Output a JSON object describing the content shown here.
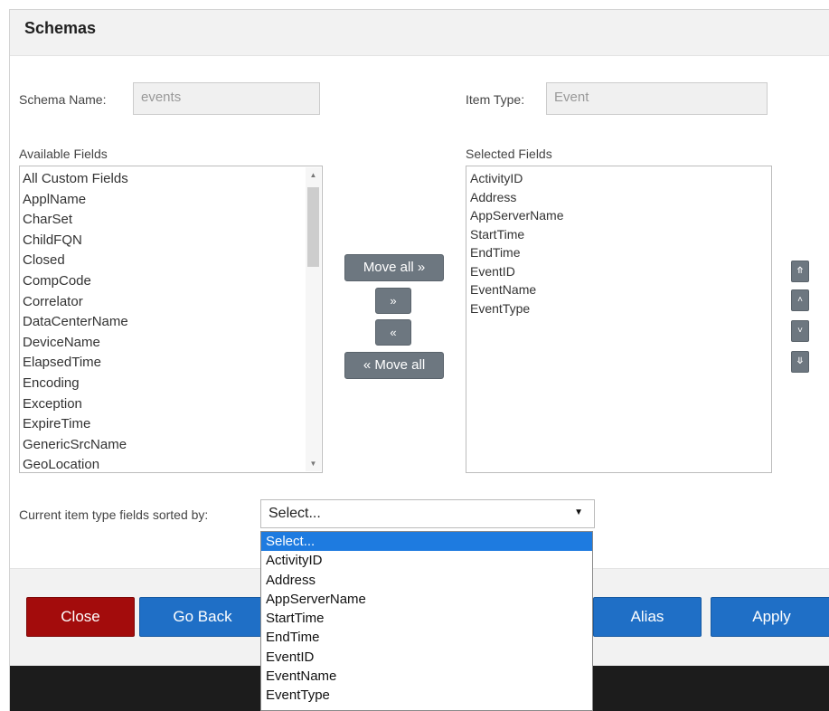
{
  "dialog": {
    "title": "Schemas"
  },
  "schema_name": {
    "label": "Schema Name:",
    "value": "events"
  },
  "item_type": {
    "label": "Item Type:",
    "value": "Event"
  },
  "available_fields": {
    "label": "Available Fields",
    "items": [
      "All Custom Fields",
      "ApplName",
      "CharSet",
      "ChildFQN",
      "Closed",
      "CompCode",
      "Correlator",
      "DataCenterName",
      "DeviceName",
      "ElapsedTime",
      "Encoding",
      "Exception",
      "ExpireTime",
      "GenericSrcName",
      "GeoLocation"
    ]
  },
  "selected_fields": {
    "label": "Selected Fields",
    "items": [
      "ActivityID",
      "Address",
      "AppServerName",
      "StartTime",
      "EndTime",
      "EventID",
      "EventName",
      "EventType"
    ]
  },
  "transfer_buttons": {
    "move_all_right": "Move all »",
    "move_right": "»",
    "move_left": "«",
    "move_all_left": "« Move all"
  },
  "order_buttons": {
    "to_top": "⤊",
    "up": "˄",
    "down": "˅",
    "to_bottom": "⤋"
  },
  "sort": {
    "label": "Current item type fields sorted by:",
    "selected": "Select...",
    "options": [
      "Select...",
      "ActivityID",
      "Address",
      "AppServerName",
      "StartTime",
      "EndTime",
      "EventID",
      "EventName",
      "EventType"
    ]
  },
  "footer": {
    "close": "Close",
    "go_back": "Go Back",
    "alias": "Alias",
    "apply": "Apply"
  },
  "colors": {
    "danger": "#a30c0c",
    "primary": "#1f6fc6",
    "move_button": "#6d7780",
    "highlight": "#1e7be0"
  }
}
